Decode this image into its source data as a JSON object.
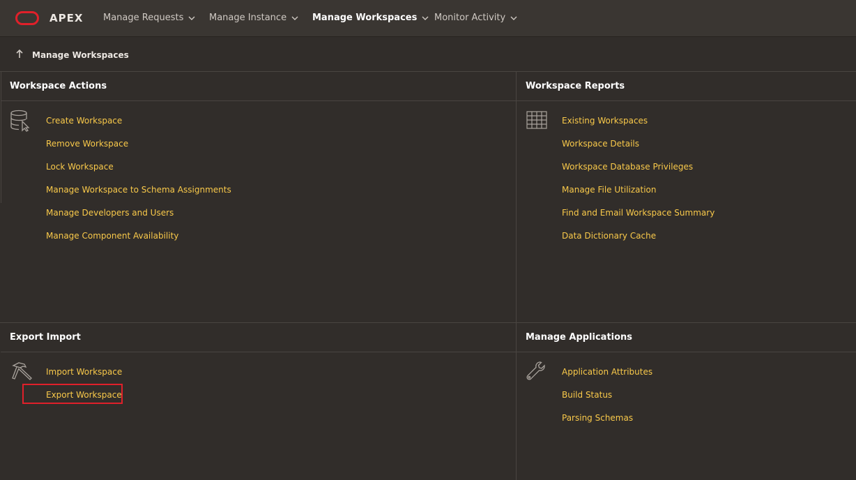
{
  "header": {
    "brand": "APEX",
    "nav": [
      {
        "label": "Manage Requests",
        "active": false
      },
      {
        "label": "Manage Instance",
        "active": false
      },
      {
        "label": "Manage Workspaces",
        "active": true
      },
      {
        "label": "Monitor Activity",
        "active": false
      }
    ]
  },
  "breadcrumb": {
    "label": "Manage Workspaces"
  },
  "workspace_actions": {
    "title": "Workspace Actions",
    "icon": "database-cursor-icon",
    "links": [
      "Create Workspace",
      "Remove Workspace",
      "Lock Workspace",
      "Manage Workspace to Schema Assignments",
      "Manage Developers and Users",
      "Manage Component Availability"
    ]
  },
  "workspace_reports": {
    "title": "Workspace Reports",
    "icon": "table-grid-icon",
    "links": [
      "Existing Workspaces",
      "Workspace Details",
      "Workspace Database Privileges",
      "Manage File Utilization",
      "Find and Email Workspace Summary",
      "Data Dictionary Cache"
    ]
  },
  "export_import": {
    "title": "Export Import",
    "icon": "hammer-icon",
    "links": [
      "Import Workspace",
      "Export Workspace"
    ]
  },
  "manage_applications": {
    "title": "Manage Applications",
    "icon": "wrench-icon",
    "links": [
      "Application Attributes",
      "Build Status",
      "Parsing Schemas"
    ]
  },
  "colors": {
    "background": "#312d2a",
    "link": "#f9c94a",
    "brand_logo": "#e0202a",
    "highlight_box": "#e0202a"
  }
}
